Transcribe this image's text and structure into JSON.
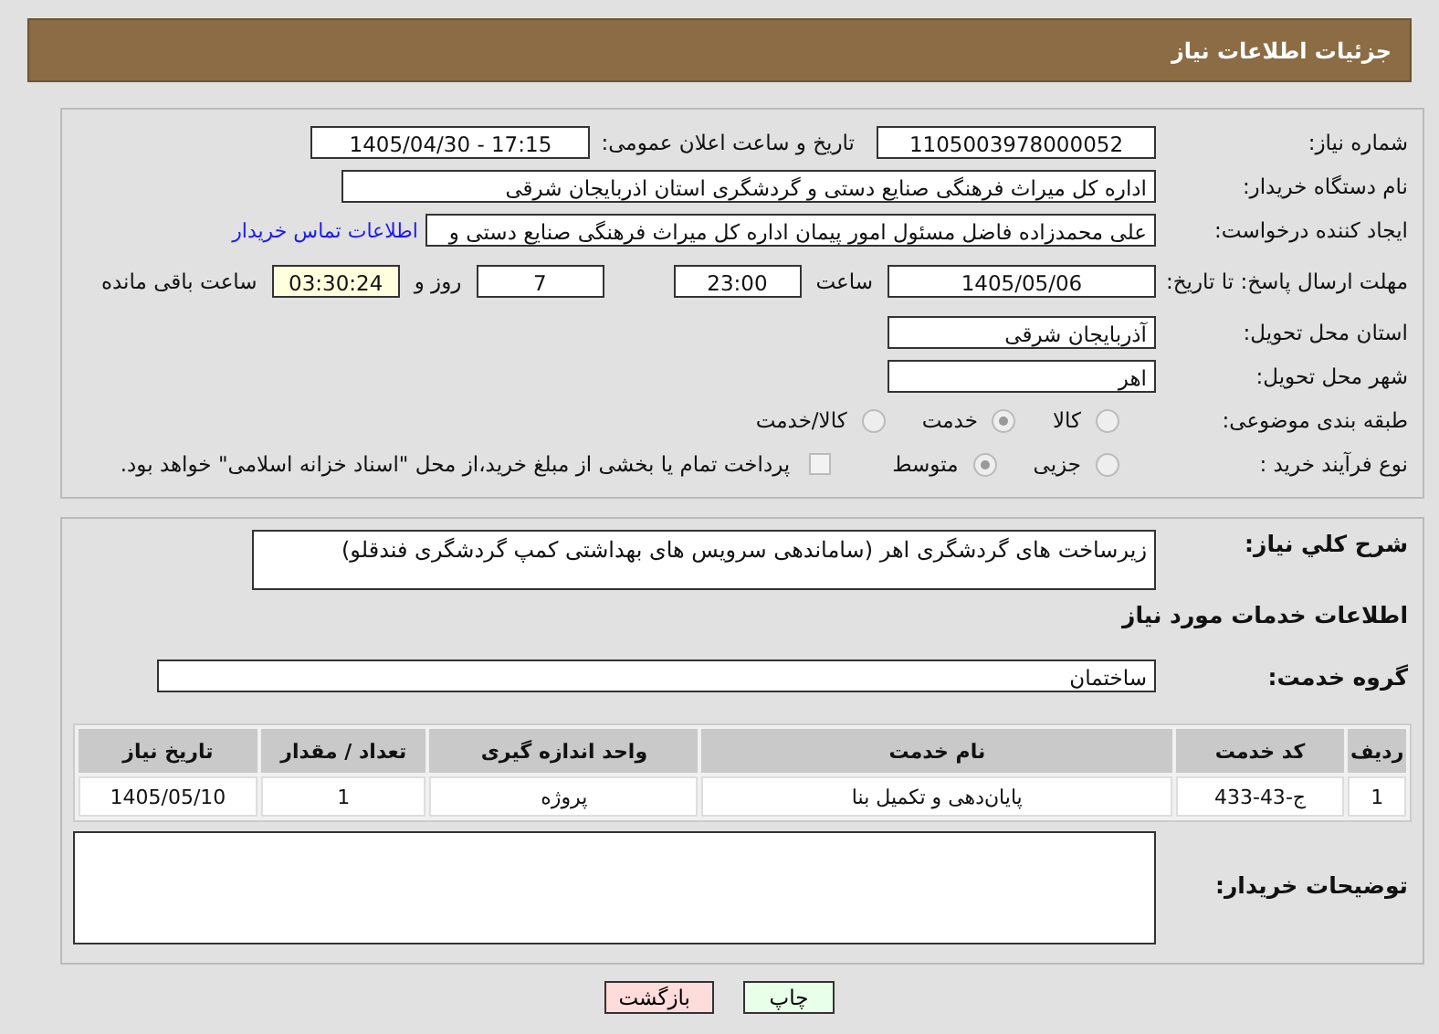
{
  "header": {
    "title": "جزئیات اطلاعات نیاز"
  },
  "need_number": {
    "label": "شماره نیاز:",
    "value": "1105003978000052"
  },
  "announce_date": {
    "label": "تاریخ و ساعت اعلان عمومی:",
    "value": "1405/04/30 - 17:15"
  },
  "buyer_org": {
    "label": "نام دستگاه خریدار:",
    "value": "اداره کل میراث فرهنگی  صنایع دستی و گردشگری استان اذربایجان شرقی"
  },
  "requester": {
    "label": "ایجاد کننده درخواست:",
    "value": "علی محمدزاده فاضل مسئول امور پیمان اداره کل میراث فرهنگی  صنایع دستی و",
    "link": "اطلاعات تماس خریدار"
  },
  "deadline": {
    "label": "مهلت ارسال پاسخ: تا تاریخ:",
    "date": "1405/05/06",
    "time_label": "ساعت",
    "time": "23:00",
    "days": "7",
    "days_label": "روز و",
    "remaining": "03:30:24",
    "remaining_label": "ساعت باقی مانده"
  },
  "province": {
    "label": "استان محل تحویل:",
    "value": "آذربایجان شرقی"
  },
  "city": {
    "label": "شهر محل تحویل:",
    "value": "اهر"
  },
  "category": {
    "label": "طبقه بندی موضوعی:",
    "options": [
      {
        "label": "کالا",
        "selected": false
      },
      {
        "label": "خدمت",
        "selected": true
      },
      {
        "label": "کالا/خدمت",
        "selected": false
      }
    ]
  },
  "purchase_type": {
    "label": "نوع فرآیند خرید :",
    "options": [
      {
        "label": "جزیی",
        "selected": false
      },
      {
        "label": "متوسط",
        "selected": true
      }
    ],
    "payment": {
      "label": "پرداخت تمام یا بخشی از مبلغ خرید،از محل \"اسناد خزانه اسلامی\" خواهد بود.",
      "checked": false
    }
  },
  "description": {
    "label": "شرح کلي نياز:",
    "value": "زیرساخت های گردشگری اهر (ساماندهی سرویس های بهداشتی کمپ گردشگری فندقلو)"
  },
  "services_title": "اطلاعات خدمات مورد نیاز",
  "service_group": {
    "label": "گروه خدمت:",
    "value": "ساختمان"
  },
  "table": {
    "columns": [
      "ردیف",
      "کد خدمت",
      "نام خدمت",
      "واحد اندازه گیری",
      "تعداد / مقدار",
      "تاریخ نیاز"
    ],
    "rows": [
      [
        "1",
        "ج-43-433",
        "پایان‌دهی و تکمیل بنا",
        "پروژه",
        "1",
        "1405/05/10"
      ]
    ]
  },
  "buyer_notes": {
    "label": "توضیحات خریدار:"
  },
  "buttons": [
    {
      "label": "چاپ",
      "kind": "print"
    },
    {
      "label": "بازگشت",
      "kind": "back"
    }
  ]
}
